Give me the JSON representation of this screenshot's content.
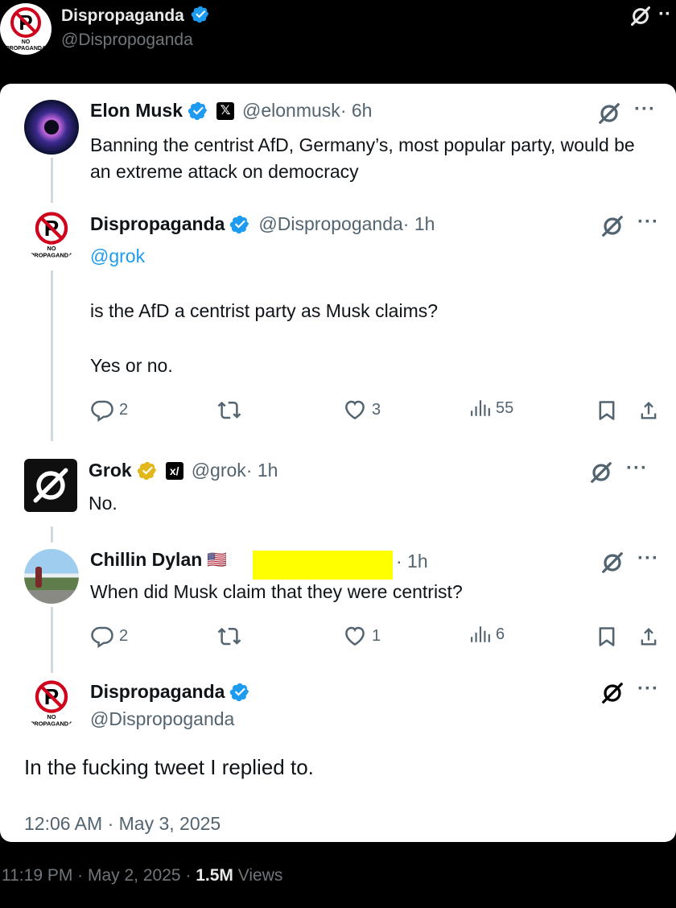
{
  "outer": {
    "name": "Dispropaganda",
    "handle": "@Dispropoganda",
    "avatar_text": "NO PROPAGANDA",
    "timestamp": "11:19 PM · May 2, 2025 · ",
    "views_count": "1.5M",
    "views_label": "Views"
  },
  "tweets": {
    "elon": {
      "name": "Elon Musk",
      "handle": "@elonmusk",
      "time": " · 6h",
      "text": "Banning the centrist AfD, Germany’s, most popular party, would be an extreme attack on democracy"
    },
    "disp1": {
      "name": "Dispropaganda",
      "handle": "@Dispropoganda",
      "time": " · 1h",
      "mention": "@grok",
      "line1": "is the AfD a centrist party as Musk claims?",
      "line2": "Yes or no.",
      "replies": "2",
      "likes": "3",
      "views": "55"
    },
    "grok": {
      "name": "Grok",
      "handle": "@grok",
      "time": " · 1h",
      "text": "No."
    },
    "dylan": {
      "name": "Chillin Dylan",
      "flag": "🇺🇸",
      "time": "· 1h",
      "text": "When did Musk claim that they were centrist?",
      "replies": "2",
      "likes": "1",
      "views": "6"
    },
    "disp2": {
      "name": "Dispropaganda",
      "handle": "@Dispropoganda",
      "text": "In the fucking tweet I replied to.",
      "timestamp": "12:06 AM · May 3, 2025"
    }
  },
  "colors": {
    "verified_blue": "#1d9bf0",
    "verified_gold": "#e2b719",
    "redaction": "#ffff00",
    "secondary_text": "#536471"
  },
  "icons": [
    "grok-slash-icon",
    "more-icon",
    "reply-icon",
    "retweet-icon",
    "like-icon",
    "views-icon",
    "bookmark-icon",
    "share-icon",
    "verified-badge-icon",
    "x-logo-icon"
  ]
}
